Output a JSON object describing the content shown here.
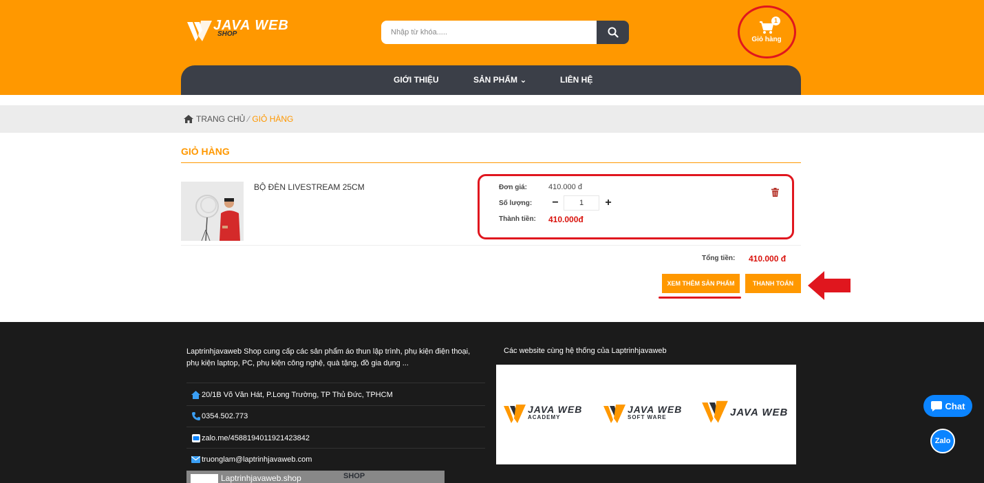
{
  "header": {
    "logo_text": "JAVA WEB",
    "logo_sub": "SHOP",
    "search_placeholder": "Nhập từ khóa.....",
    "cart_count": "1",
    "cart_label": "Giỏ hàng",
    "brand_color": "#ff9800",
    "nav": [
      {
        "label": "GIỚI THIỆU"
      },
      {
        "label": "SẢN PHẨM ⌄"
      },
      {
        "label": "LIÊN HỆ"
      }
    ]
  },
  "breadcrumb": {
    "home": "TRANG CHỦ",
    "separator": "⁄",
    "current": "GIỎ HÀNG"
  },
  "cart": {
    "title": "GIỎ HÀNG",
    "item": {
      "name": "BỘ ĐÈN LIVESTREAM 25CM",
      "unit_price_label": "Đơn giá:",
      "unit_price": "410.000 đ",
      "quantity_label": "Số lượng:",
      "quantity": "1",
      "minus": "−",
      "plus": "+",
      "subtotal_label": "Thành tiền:",
      "subtotal": "410.000đ"
    },
    "total_label": "Tổng tiền:",
    "total": "410.000 đ",
    "more_button": "XEM THÊM SẢN PHẨM",
    "pay_button": "THANH TOÁN"
  },
  "footer": {
    "intro": "Laptrinhjavaweb Shop cung cấp các sản phẩm áo thun lập trình, phụ kiện điện thoại, phụ kiện laptop, PC, phụ kiện công nghệ, quà tặng, đồ gia dụng ...",
    "address": "20/1B Võ Văn Hát, P.Long Trường, TP Thủ Đức, TPHCM",
    "phone": "0354.502.773",
    "zalo": "zalo.me/4588194011921423842",
    "email": "truonglam@laptrinhjavaweb.com",
    "partners_title": "Các website cùng hệ thống của Laptrinhjavaweb",
    "partners": [
      {
        "name": "JAVA WEB",
        "sub": "ACADEMY"
      },
      {
        "name": "JAVA WEB",
        "sub": "SOFT WARE"
      },
      {
        "name": "JAVA WEB",
        "sub": ""
      }
    ],
    "video_title": "Laptrinhjavaweb.shop",
    "video_logo": "SHOP"
  },
  "widgets": {
    "chat": "Chat",
    "zalo": "Zalo"
  }
}
